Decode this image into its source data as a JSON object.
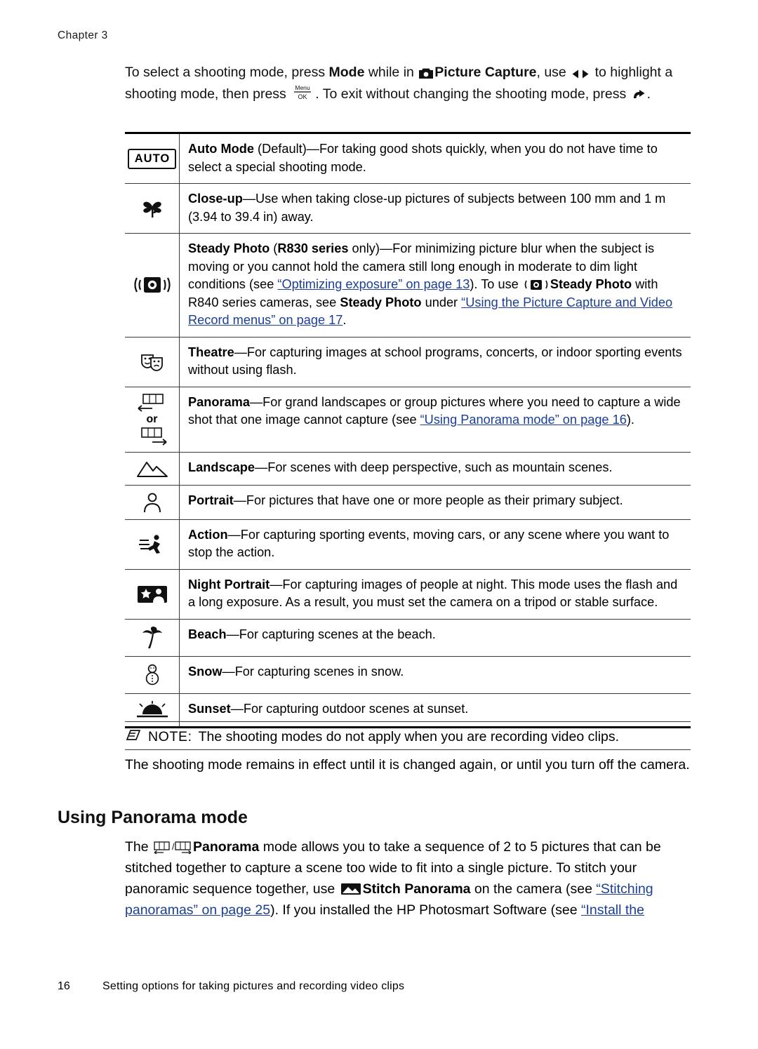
{
  "header": {
    "chapter": "Chapter 3"
  },
  "intro": {
    "part1": "To select a shooting mode, press ",
    "mode_bold": "Mode",
    "part2": " while in ",
    "picture_capture_bold": "Picture Capture",
    "part3": ", use ",
    "part4": " to highlight a shooting mode, then press ",
    "part5": ". To exit without changing the shooting mode, press ",
    "part6": "."
  },
  "table": {
    "rows": [
      {
        "icon": "auto-mode-icon",
        "icon_label": "AUTO",
        "title": "Auto Mode",
        "title_suffix": " (Default)",
        "body": "—For taking good shots quickly, when you do not have time to select a special shooting mode."
      },
      {
        "icon": "close-up-flower-icon",
        "title": "Close-up",
        "body": "—Use when taking close-up pictures of subjects between 100 mm and 1 m (3.94 to 39.4 in) away."
      },
      {
        "icon": "steady-photo-icon",
        "title": "Steady Photo",
        "title_paren": " (R830 series",
        "title_paren_rest": " only)",
        "body_1": "—For minimizing picture blur when the subject is moving or you cannot hold the camera still long enough in moderate to dim light conditions (see ",
        "link_1": "“Optimizing exposure” on page 13",
        "body_2": "). To use ",
        "body_3": " ",
        "bold_2": "Steady Photo",
        "body_4": " with R840 series cameras, see ",
        "bold_3": "Steady Photo",
        "body_5": " under ",
        "link_2": "“Using the Picture Capture and Video Record menus” on page 17",
        "body_6": "."
      },
      {
        "icon": "theatre-masks-icon",
        "title": "Theatre",
        "body": "—For capturing images at school programs, concerts, or indoor sporting events without using flash."
      },
      {
        "icon": "panorama-left-icon",
        "icon2": "panorama-right-icon",
        "or_label": "or",
        "title": "Panorama",
        "body_1": "—For grand landscapes or group pictures where you need to capture a wide shot that one image cannot capture (see ",
        "link_1": "“Using Panorama mode” on page 16",
        "body_2": ")."
      },
      {
        "icon": "landscape-mountain-icon",
        "title": "Landscape",
        "body": "—For scenes with deep perspective, such as mountain scenes."
      },
      {
        "icon": "portrait-person-icon",
        "title": "Portrait",
        "body": "—For pictures that have one or more people as their primary subject."
      },
      {
        "icon": "action-runner-icon",
        "title": "Action",
        "body": "—For capturing sporting events, moving cars, or any scene where you want to stop the action."
      },
      {
        "icon": "night-portrait-icon",
        "title": "Night Portrait",
        "body": "—For capturing images of people at night. This mode uses the flash and a long exposure. As a result, you must set the camera on a tripod or stable surface."
      },
      {
        "icon": "beach-palm-icon",
        "title": "Beach",
        "body": "—For capturing scenes at the beach."
      },
      {
        "icon": "snow-snowman-icon",
        "title": "Snow",
        "body": "—For capturing scenes in snow."
      },
      {
        "icon": "sunset-icon",
        "title": "Sunset",
        "body": "—For capturing outdoor scenes at sunset."
      }
    ]
  },
  "note": {
    "icon": "note-pencil-icon",
    "label": "NOTE:",
    "text": "The shooting modes do not apply when you are recording video clips."
  },
  "after_note": {
    "text": "The shooting mode remains in effect until it is changed again, or until you turn off the camera."
  },
  "section": {
    "heading": "Using Panorama mode"
  },
  "panorama_body": {
    "part1": "The ",
    "bold1": "Panorama",
    "part2": " mode allows you to take a sequence of 2 to 5 pictures that can be stitched together to capture a scene too wide to fit into a single picture. To stitch your panoramic sequence together, use ",
    "bold2": "Stitch Panorama",
    "part3": " on the camera (see ",
    "link1": "“Stitching panoramas” on page 25",
    "part4": "). If you installed the HP Photosmart Software (see ",
    "link2": "“Install the",
    "part5": ""
  },
  "footer": {
    "page_number": "16",
    "text": "Setting options for taking pictures and recording video clips"
  },
  "colors": {
    "link": "#1b3f94",
    "rule": "#000000",
    "text": "#111111"
  }
}
